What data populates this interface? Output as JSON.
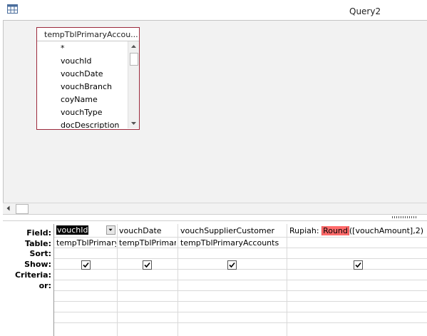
{
  "window": {
    "title": "Query2"
  },
  "table_box": {
    "title": "tempTblPrimaryAccou...",
    "fields": [
      "*",
      "vouchId",
      "vouchDate",
      "vouchBranch",
      "coyName",
      "vouchType",
      "docDescription"
    ]
  },
  "grid": {
    "row_labels": {
      "field": "Field:",
      "table": "Table:",
      "sort": "Sort:",
      "show": "Show:",
      "criteria": "Criteria:",
      "or": "or:"
    },
    "columns": [
      {
        "field": "vouchId",
        "table": "tempTblPrimaryA",
        "show": true
      },
      {
        "field": "vouchDate",
        "table": "tempTblPrimaryA",
        "show": true
      },
      {
        "field": "vouchSupplierCustomer",
        "table": "tempTblPrimaryAccounts",
        "show": true
      },
      {
        "field_prefix": "Rupiah: ",
        "field_highlight": "Round",
        "field_suffix": "([vouchAmount],2)",
        "table": "",
        "show": true
      }
    ]
  },
  "colors": {
    "highlight": "#ff6b6b",
    "box_border": "#9c2a3c"
  }
}
